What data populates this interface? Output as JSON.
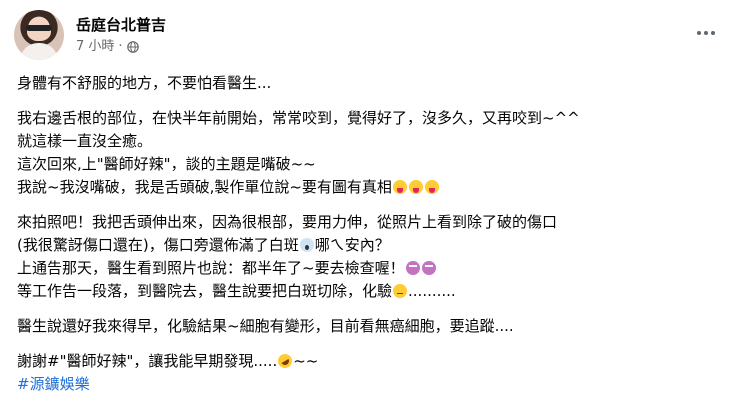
{
  "post": {
    "page_name": "岳庭台北普吉",
    "time": "7 小時",
    "separator": "·",
    "privacy_icon": "globe-icon",
    "more_icon": "more-dots-icon",
    "paragraphs": [
      {
        "lines": [
          {
            "text": "身體有不舒服的地方，不要怕看醫生..."
          }
        ]
      },
      {
        "lines": [
          {
            "text": "我右邊舌根的部位，在快半年前開始，常常咬到，覺得好了，沒多久，又再咬到~^^"
          },
          {
            "text": "就這樣一直沒全癒。"
          },
          {
            "text": "這次回來,上\"醫師好辣\"，談的主題是嘴破~~"
          },
          {
            "text": "我說~我沒嘴破，我是舌頭破,製作單位說~要有圖有真相"
          }
        ]
      },
      {
        "lines": [
          {
            "text": "來拍照吧！我把舌頭伸出來，因為很根部，要用力伸，從照片上看到除了破的傷口"
          },
          {
            "text": "(我很驚訝傷口還在)，傷口旁還佈滿了白斑"
          },
          {
            "text": "上通告那天，醫生看到照片也說：都半年了~要去檢查喔！"
          },
          {
            "text": "等工作告一段落，到醫院去，醫生說要把白斑切除，化驗"
          }
        ]
      },
      {
        "lines": [
          {
            "text": "醫生說還好我來得早，化驗結果~細胞有變形，目前看無癌細胞，要追蹤...."
          }
        ]
      },
      {
        "lines": [
          {
            "text": "謝謝#\"醫師好辣\"，讓我能早期發現....."
          }
        ]
      }
    ],
    "inline_text": {
      "scream_after": "哪ㄟ安內？",
      "unamused_after": "..........",
      "rofl_after": "~~"
    },
    "emojis": {
      "tongue": "face-with-tongue-emoji",
      "scream": "face-screaming-in-fear-emoji",
      "dizzy": "dizzy-face-emoji",
      "unamused": "unamused-face-emoji",
      "rofl": "rolling-on-floor-laughing-emoji"
    },
    "hashtag": "#源鑛娛樂"
  },
  "colors": {
    "text": "#050505",
    "meta": "#65676b",
    "link": "#216fdb",
    "background": "#ffffff"
  }
}
